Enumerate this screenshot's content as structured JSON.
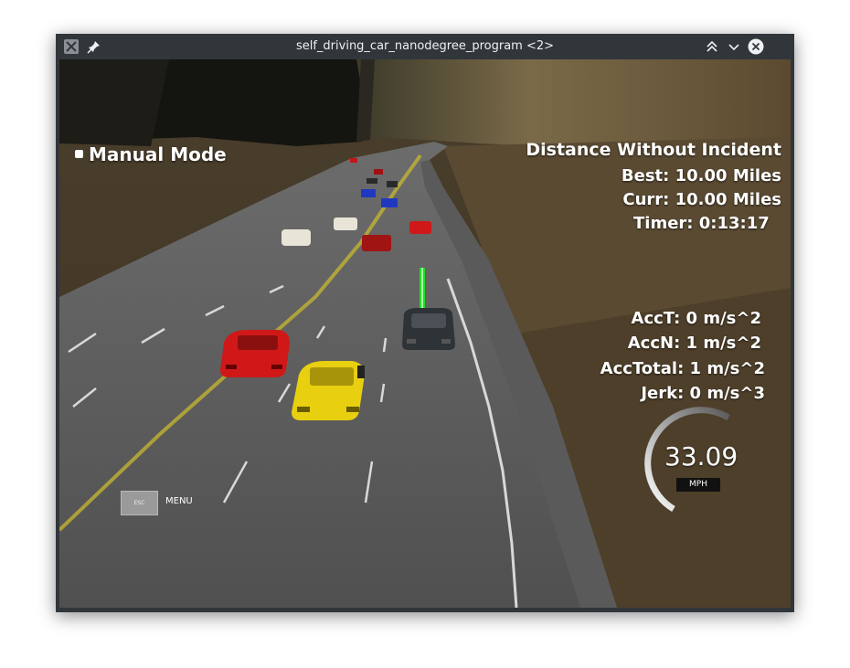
{
  "window": {
    "title": "self_driving_car_nanodegree_program <2>",
    "icons": [
      "app-icon",
      "pin-icon",
      "keep-above-icon",
      "minimize-icon",
      "close-icon"
    ]
  },
  "hud": {
    "mode_label": "Manual Mode",
    "distance_header": "Distance Without Incident",
    "best": "Best: 10.00 Miles",
    "curr": "Curr: 10.00 Miles",
    "timer": "Timer: 0:13:17",
    "acc_t": "AccT: 0 m/s^2",
    "acc_n": "AccN: 1 m/s^2",
    "acc_total": "AccTotal: 1 m/s^2",
    "jerk": "Jerk: 0 m/s^3",
    "speed_value": "33.09",
    "speed_unit": "MPH",
    "esc_key": "ESC",
    "menu_label": "MENU"
  },
  "colors": {
    "planned_path": "#22dd22",
    "ego_car": "#2e3338",
    "car_red": "#d01818",
    "car_yellow": "#e8d010",
    "car_blue": "#2038c0",
    "car_white": "#e8e4d8"
  }
}
